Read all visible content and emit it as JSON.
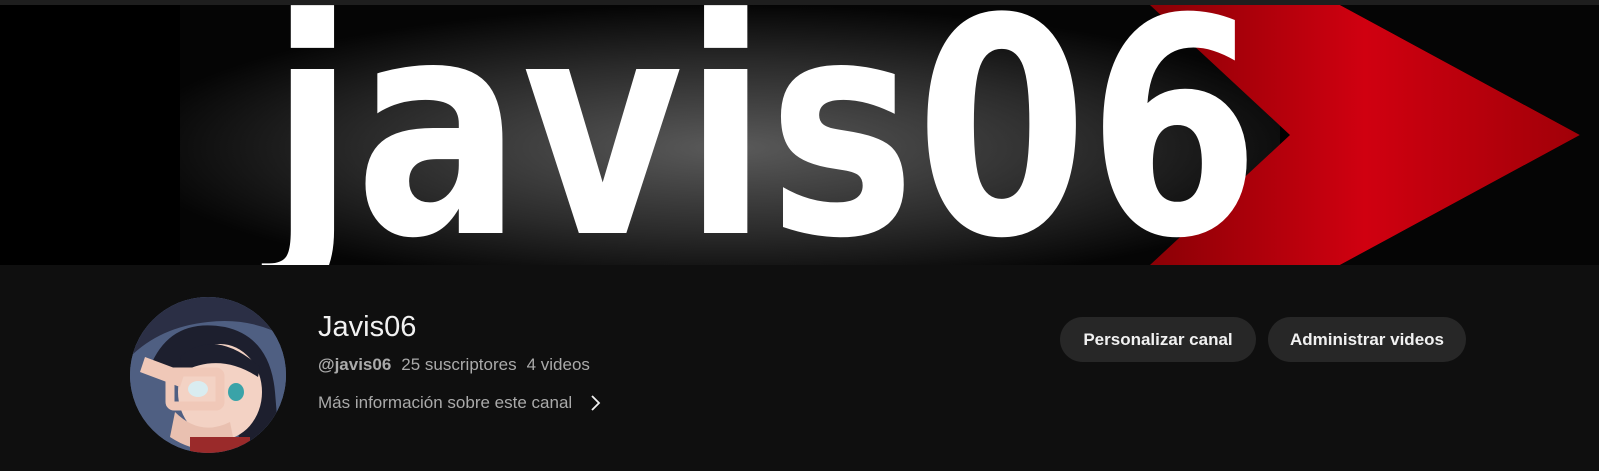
{
  "banner": {
    "text": "javis06"
  },
  "channel": {
    "name": "Javis06",
    "handle": "@javis06",
    "subscribers": "25 suscriptores",
    "videos": "4 videos",
    "more_info": "Más información sobre este canal"
  },
  "actions": {
    "customize_label": "Personalizar canal",
    "manage_label": "Administrar videos"
  },
  "colors": {
    "background": "#0f0f0f",
    "button_bg": "#272727",
    "secondary_text": "#aaaaaa",
    "banner_red": "#c8000a"
  },
  "icons": {
    "more_info": "chevron-right-icon"
  }
}
